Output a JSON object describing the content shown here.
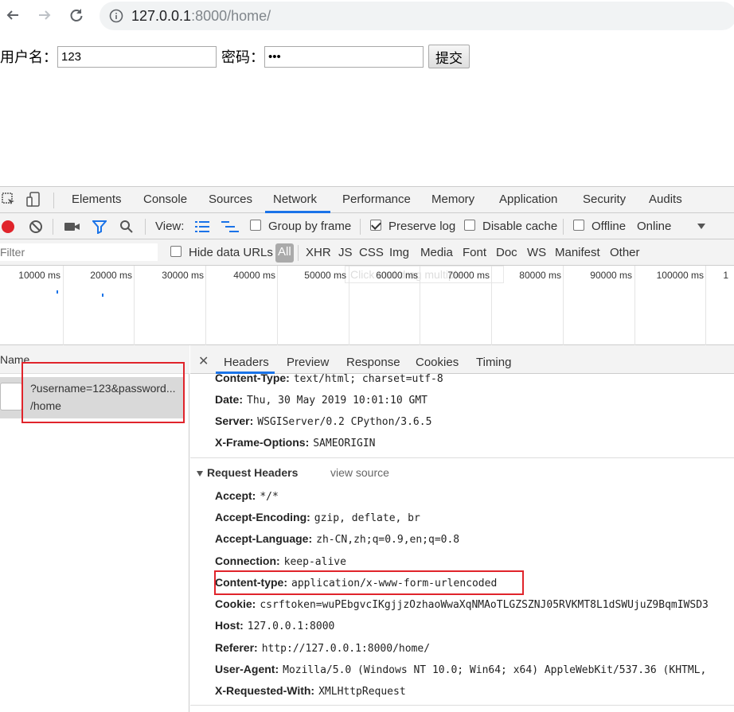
{
  "browser": {
    "url_host": "127.0.0.1",
    "url_path": ":8000/home/"
  },
  "form": {
    "username_label": "用户名：",
    "username_value": "123",
    "password_label": "密码：",
    "password_value": "•••",
    "submit_label": "提交"
  },
  "devtools": {
    "tabs": [
      "Elements",
      "Console",
      "Sources",
      "Network",
      "Performance",
      "Memory",
      "Application",
      "Security",
      "Audits"
    ],
    "active_tab": "Network",
    "toolbar": {
      "view_label": "View:",
      "group_by_frame": "Group by frame",
      "preserve_log": "Preserve log",
      "disable_cache": "Disable cache",
      "offline": "Offline",
      "online": "Online"
    },
    "filter": {
      "placeholder": "Filter",
      "hide_data_urls": "Hide data URLs",
      "types": [
        "All",
        "XHR",
        "JS",
        "CSS",
        "Img",
        "Media",
        "Font",
        "Doc",
        "WS",
        "Manifest",
        "Other"
      ]
    },
    "timeline": {
      "ticks": [
        "10000 ms",
        "20000 ms",
        "30000 ms",
        "40000 ms",
        "50000 ms",
        "60000 ms",
        "70000 ms",
        "80000 ms",
        "90000 ms",
        "100000 ms",
        "1"
      ],
      "hint": "Click and drag multiple"
    },
    "requests": {
      "column_name": "Name",
      "items": [
        {
          "name": "?username=123&password...",
          "path": "/home"
        }
      ]
    },
    "detail": {
      "tabs": [
        "Headers",
        "Preview",
        "Response",
        "Cookies",
        "Timing"
      ],
      "active_tab": "Headers",
      "response_headers": [
        {
          "key": "Content-Type:",
          "value": "text/html; charset=utf-8"
        },
        {
          "key": "Date:",
          "value": "Thu, 30 May 2019 10:01:10 GMT"
        },
        {
          "key": "Server:",
          "value": "WSGIServer/0.2 CPython/3.6.5"
        },
        {
          "key": "X-Frame-Options:",
          "value": "SAMEORIGIN"
        }
      ],
      "request_section_title": "Request Headers",
      "view_source": "view source",
      "request_headers": [
        {
          "key": "Accept:",
          "value": "*/*"
        },
        {
          "key": "Accept-Encoding:",
          "value": "gzip, deflate, br"
        },
        {
          "key": "Accept-Language:",
          "value": "zh-CN,zh;q=0.9,en;q=0.8"
        },
        {
          "key": "Connection:",
          "value": "keep-alive"
        },
        {
          "key": "Content-type:",
          "value": "application/x-www-form-urlencoded"
        },
        {
          "key": "Cookie:",
          "value": "csrftoken=wuPEbgvcIKgjjzOzhaoWwaXqNMAoTLGZSZNJ05RVKMT8L1dSWUjuZ9BqmIWSD3"
        },
        {
          "key": "Host:",
          "value": "127.0.0.1:8000"
        },
        {
          "key": "Referer:",
          "value": "http://127.0.0.1:8000/home/"
        },
        {
          "key": "User-Agent:",
          "value": "Mozilla/5.0 (Windows NT 10.0; Win64; x64) AppleWebKit/537.36 (KHTML,"
        },
        {
          "key": "X-Requested-With:",
          "value": "XMLHttpRequest"
        }
      ]
    }
  },
  "colors": {
    "highlight": "#e0242b",
    "accent": "#1a73e8",
    "record": "#e0242b"
  }
}
